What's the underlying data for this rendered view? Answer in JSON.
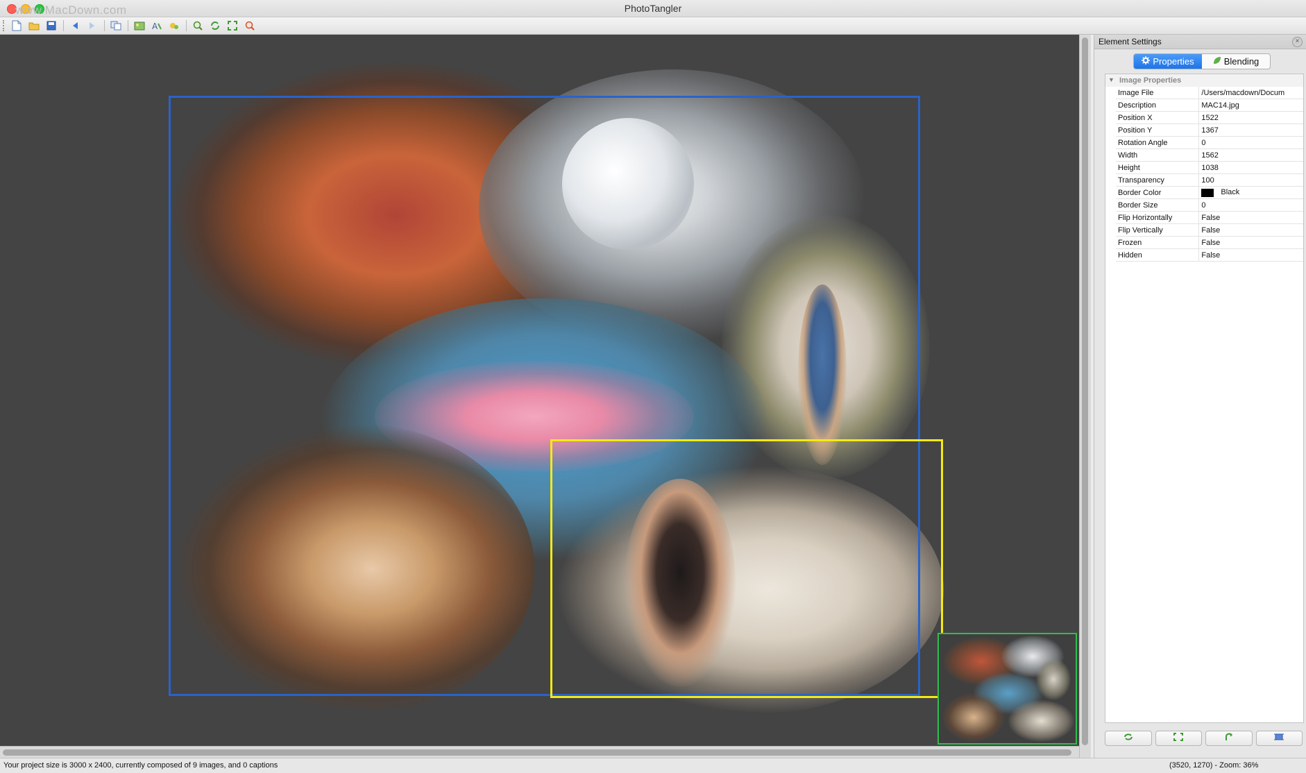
{
  "window": {
    "title": "PhotoTangler",
    "watermark": "www.MacDown.com"
  },
  "toolbar": {
    "buttons": [
      "new-project-icon",
      "open-icon",
      "save-icon",
      "undo-icon",
      "redo-icon",
      "copy-icon",
      "add-image-icon",
      "add-caption-icon",
      "add-effect-icon",
      "zoom-in-icon",
      "refresh-icon",
      "fit-icon",
      "zoom-out-icon"
    ]
  },
  "panel": {
    "title": "Element Settings",
    "tabs": [
      {
        "label": "Properties",
        "icon": "gear-icon",
        "active": true
      },
      {
        "label": "Blending",
        "icon": "leaf-icon",
        "active": false
      }
    ],
    "group": "Image Properties",
    "properties": [
      {
        "key": "Image File",
        "value": "/Users/macdown/Docum"
      },
      {
        "key": "Description",
        "value": "MAC14.jpg"
      },
      {
        "key": "Position X",
        "value": "1522"
      },
      {
        "key": "Position Y",
        "value": "1367"
      },
      {
        "key": "Rotation Angle",
        "value": "0"
      },
      {
        "key": "Width",
        "value": "1562"
      },
      {
        "key": "Height",
        "value": "1038"
      },
      {
        "key": "Transparency",
        "value": "100"
      },
      {
        "key": "Border Color",
        "value": "Black"
      },
      {
        "key": "Border Size",
        "value": "0"
      },
      {
        "key": "Flip Horizontally",
        "value": "False"
      },
      {
        "key": "Flip Vertically",
        "value": "False"
      },
      {
        "key": "Frozen",
        "value": "False"
      },
      {
        "key": "Hidden",
        "value": "False"
      }
    ]
  },
  "status": {
    "left": "Your project size is 3000 x 2400, currently composed of 9 images, and 0 captions",
    "right": "(3520, 1270) - Zoom: 36%"
  },
  "colors": {
    "canvas": "#444444",
    "selection_blue": "#2a63c9",
    "selection_yellow": "#f4ea12",
    "navigator_border": "#2fbf4d",
    "active_tab": "#1e74e8"
  }
}
